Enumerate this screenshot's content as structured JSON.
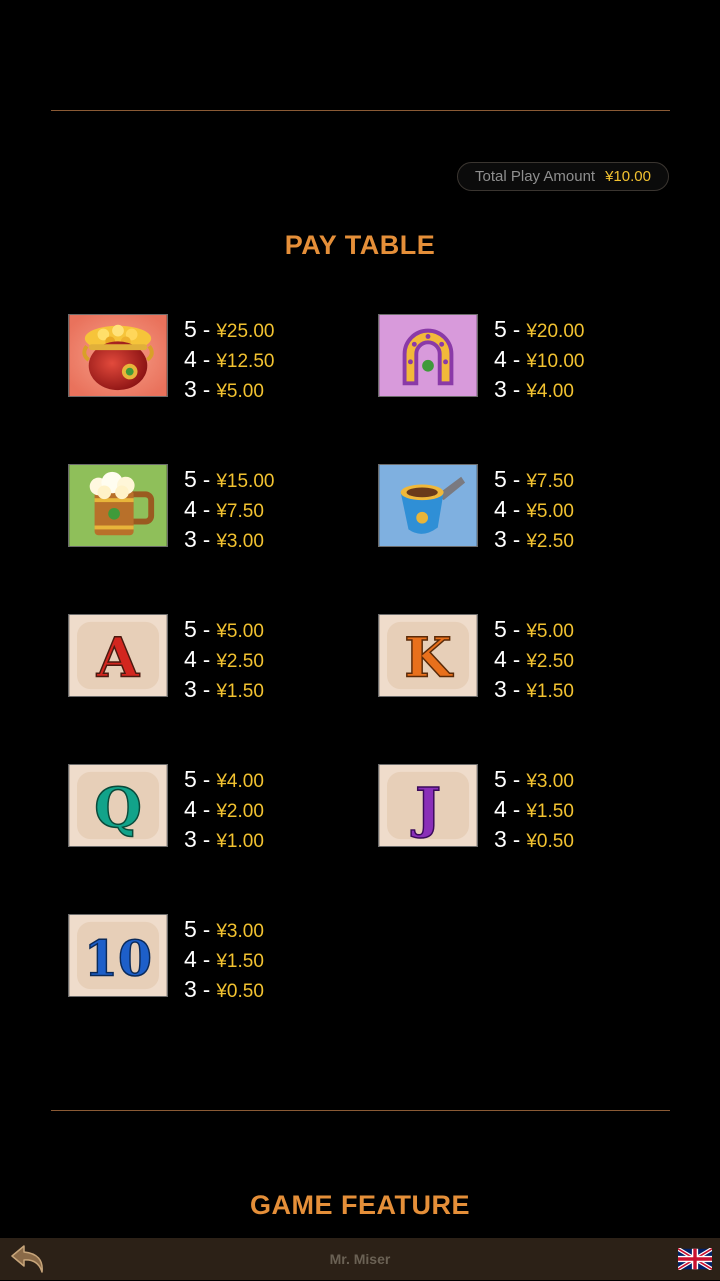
{
  "header": {
    "total_play_label": "Total Play Amount",
    "total_play_value": "¥10.00"
  },
  "pay_table": {
    "title": "PAY TABLE",
    "symbols": [
      {
        "name": "pot-of-gold",
        "icon": "pot-of-gold-icon",
        "payouts": [
          {
            "count": "5",
            "amount": "¥25.00"
          },
          {
            "count": "4",
            "amount": "¥12.50"
          },
          {
            "count": "3",
            "amount": "¥5.00"
          }
        ]
      },
      {
        "name": "horseshoe",
        "icon": "horseshoe-icon",
        "payouts": [
          {
            "count": "5",
            "amount": "¥20.00"
          },
          {
            "count": "4",
            "amount": "¥10.00"
          },
          {
            "count": "3",
            "amount": "¥4.00"
          }
        ]
      },
      {
        "name": "beer-mug",
        "icon": "beer-mug-icon",
        "payouts": [
          {
            "count": "5",
            "amount": "¥15.00"
          },
          {
            "count": "4",
            "amount": "¥7.50"
          },
          {
            "count": "3",
            "amount": "¥3.00"
          }
        ]
      },
      {
        "name": "pipe",
        "icon": "pipe-icon",
        "payouts": [
          {
            "count": "5",
            "amount": "¥7.50"
          },
          {
            "count": "4",
            "amount": "¥5.00"
          },
          {
            "count": "3",
            "amount": "¥2.50"
          }
        ]
      },
      {
        "name": "letter-a",
        "icon": "letter-a-icon",
        "letter": "A",
        "letter_color": "#d2261f",
        "payouts": [
          {
            "count": "5",
            "amount": "¥5.00"
          },
          {
            "count": "4",
            "amount": "¥2.50"
          },
          {
            "count": "3",
            "amount": "¥1.50"
          }
        ]
      },
      {
        "name": "letter-k",
        "icon": "letter-k-icon",
        "letter": "K",
        "letter_color": "#e8701c",
        "payouts": [
          {
            "count": "5",
            "amount": "¥5.00"
          },
          {
            "count": "4",
            "amount": "¥2.50"
          },
          {
            "count": "3",
            "amount": "¥1.50"
          }
        ]
      },
      {
        "name": "letter-q",
        "icon": "letter-q-icon",
        "letter": "Q",
        "letter_color": "#12a38a",
        "payouts": [
          {
            "count": "5",
            "amount": "¥4.00"
          },
          {
            "count": "4",
            "amount": "¥2.00"
          },
          {
            "count": "3",
            "amount": "¥1.00"
          }
        ]
      },
      {
        "name": "letter-j",
        "icon": "letter-j-icon",
        "letter": "J",
        "letter_color": "#8a2fb8",
        "payouts": [
          {
            "count": "5",
            "amount": "¥3.00"
          },
          {
            "count": "4",
            "amount": "¥1.50"
          },
          {
            "count": "3",
            "amount": "¥0.50"
          }
        ]
      },
      {
        "name": "number-10",
        "icon": "number-10-icon",
        "letter": "10",
        "letter_color": "#1d5fc9",
        "payouts": [
          {
            "count": "5",
            "amount": "¥3.00"
          },
          {
            "count": "4",
            "amount": "¥1.50"
          },
          {
            "count": "3",
            "amount": "¥0.50"
          }
        ]
      }
    ]
  },
  "game_feature": {
    "title": "GAME FEATURE"
  },
  "footer": {
    "game_name": "Mr. Miser",
    "back_icon": "back-arrow-icon",
    "language_icon": "uk-flag-icon"
  },
  "colors": {
    "accent": "#e58f39",
    "amount": "#f2c230",
    "divider": "#8a5a35",
    "footer_bg": "#2c2117"
  }
}
